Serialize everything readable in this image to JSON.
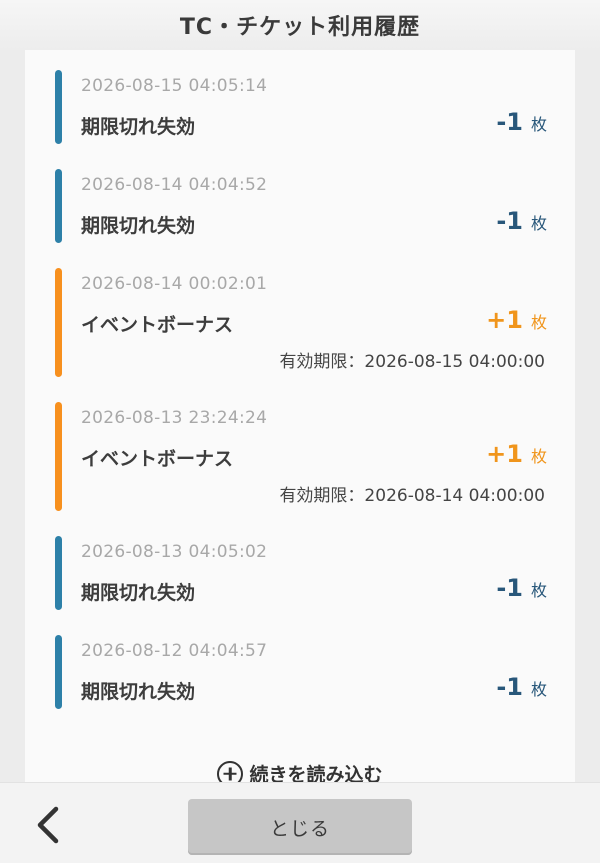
{
  "header": {
    "title": "TC・チケット利用履歴"
  },
  "entries": [
    {
      "timestamp": "2026-08-15 04:05:14",
      "label": "期限切れ失効",
      "amount": "-1",
      "unit": "枚",
      "type": "minus",
      "expiry": null
    },
    {
      "timestamp": "2026-08-14 04:04:52",
      "label": "期限切れ失効",
      "amount": "-1",
      "unit": "枚",
      "type": "minus",
      "expiry": null
    },
    {
      "timestamp": "2026-08-14 00:02:01",
      "label": "イベントボーナス",
      "amount": "+1",
      "unit": "枚",
      "type": "plus",
      "expiry": "有効期限：2026-08-15 04:00:00"
    },
    {
      "timestamp": "2026-08-13 23:24:24",
      "label": "イベントボーナス",
      "amount": "+1",
      "unit": "枚",
      "type": "plus",
      "expiry": "有効期限：2026-08-14 04:00:00"
    },
    {
      "timestamp": "2026-08-13 04:05:02",
      "label": "期限切れ失効",
      "amount": "-1",
      "unit": "枚",
      "type": "minus",
      "expiry": null
    },
    {
      "timestamp": "2026-08-12 04:04:57",
      "label": "期限切れ失効",
      "amount": "-1",
      "unit": "枚",
      "type": "minus",
      "expiry": null
    }
  ],
  "load_more": {
    "label": "続きを読み込む",
    "icon": "plus-circle-icon"
  },
  "footer": {
    "back_icon": "chevron-left-icon",
    "close_label": "とじる"
  },
  "colors": {
    "minus_bar": "#2d80a8",
    "plus_bar": "#f7901e",
    "minus_text": "#28577a",
    "plus_text": "#f0951c"
  }
}
